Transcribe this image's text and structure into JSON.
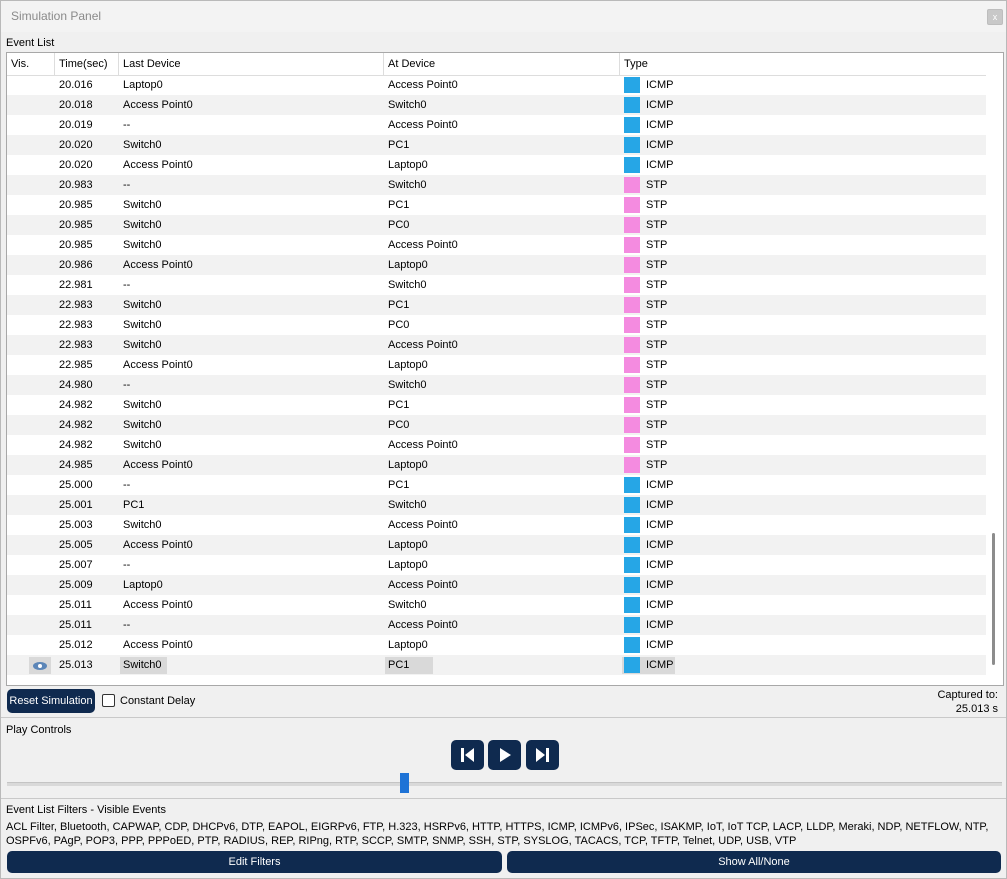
{
  "window": {
    "title": "Simulation Panel",
    "close_label": "x"
  },
  "event_list": {
    "label": "Event List",
    "columns": [
      "Vis.",
      "Time(sec)",
      "Last Device",
      "At Device",
      "Type"
    ],
    "rows": [
      {
        "time": "20.016",
        "last": "Laptop0",
        "at": "Access Point0",
        "type": "ICMP"
      },
      {
        "time": "20.018",
        "last": "Access Point0",
        "at": "Switch0",
        "type": "ICMP"
      },
      {
        "time": "20.019",
        "last": "--",
        "at": "Access Point0",
        "type": "ICMP"
      },
      {
        "time": "20.020",
        "last": "Switch0",
        "at": "PC1",
        "type": "ICMP"
      },
      {
        "time": "20.020",
        "last": "Access Point0",
        "at": "Laptop0",
        "type": "ICMP"
      },
      {
        "time": "20.983",
        "last": "--",
        "at": "Switch0",
        "type": "STP"
      },
      {
        "time": "20.985",
        "last": "Switch0",
        "at": "PC1",
        "type": "STP"
      },
      {
        "time": "20.985",
        "last": "Switch0",
        "at": "PC0",
        "type": "STP"
      },
      {
        "time": "20.985",
        "last": "Switch0",
        "at": "Access Point0",
        "type": "STP"
      },
      {
        "time": "20.986",
        "last": "Access Point0",
        "at": "Laptop0",
        "type": "STP"
      },
      {
        "time": "22.981",
        "last": "--",
        "at": "Switch0",
        "type": "STP"
      },
      {
        "time": "22.983",
        "last": "Switch0",
        "at": "PC1",
        "type": "STP"
      },
      {
        "time": "22.983",
        "last": "Switch0",
        "at": "PC0",
        "type": "STP"
      },
      {
        "time": "22.983",
        "last": "Switch0",
        "at": "Access Point0",
        "type": "STP"
      },
      {
        "time": "22.985",
        "last": "Access Point0",
        "at": "Laptop0",
        "type": "STP"
      },
      {
        "time": "24.980",
        "last": "--",
        "at": "Switch0",
        "type": "STP"
      },
      {
        "time": "24.982",
        "last": "Switch0",
        "at": "PC1",
        "type": "STP"
      },
      {
        "time": "24.982",
        "last": "Switch0",
        "at": "PC0",
        "type": "STP"
      },
      {
        "time": "24.982",
        "last": "Switch0",
        "at": "Access Point0",
        "type": "STP"
      },
      {
        "time": "24.985",
        "last": "Access Point0",
        "at": "Laptop0",
        "type": "STP"
      },
      {
        "time": "25.000",
        "last": "--",
        "at": "PC1",
        "type": "ICMP"
      },
      {
        "time": "25.001",
        "last": "PC1",
        "at": "Switch0",
        "type": "ICMP"
      },
      {
        "time": "25.003",
        "last": "Switch0",
        "at": "Access Point0",
        "type": "ICMP"
      },
      {
        "time": "25.005",
        "last": "Access Point0",
        "at": "Laptop0",
        "type": "ICMP"
      },
      {
        "time": "25.007",
        "last": "--",
        "at": "Laptop0",
        "type": "ICMP"
      },
      {
        "time": "25.009",
        "last": "Laptop0",
        "at": "Access Point0",
        "type": "ICMP"
      },
      {
        "time": "25.011",
        "last": "Access Point0",
        "at": "Switch0",
        "type": "ICMP"
      },
      {
        "time": "25.011",
        "last": "--",
        "at": "Access Point0",
        "type": "ICMP"
      },
      {
        "time": "25.012",
        "last": "Access Point0",
        "at": "Laptop0",
        "type": "ICMP"
      },
      {
        "time": "25.013",
        "last": "Switch0",
        "at": "PC1",
        "type": "ICMP",
        "selected": true,
        "vis_icon": "eye-icon"
      }
    ]
  },
  "type_colors": {
    "ICMP": "#26a6e6",
    "STP": "#f48be0"
  },
  "controls": {
    "reset_label": "Reset Simulation",
    "constant_delay_label": "Constant Delay",
    "constant_delay_checked": false,
    "captured_label": "Captured to:",
    "captured_value": "25.013 s"
  },
  "play_controls": {
    "label": "Play Controls",
    "buttons": [
      "step-back-icon",
      "play-icon",
      "step-forward-icon"
    ]
  },
  "filters": {
    "label": "Event List Filters - Visible Events",
    "text": "ACL Filter, Bluetooth, CAPWAP, CDP, DHCPv6, DTP, EAPOL, EIGRPv6, FTP, H.323, HSRPv6, HTTP, HTTPS, ICMP, ICMPv6, IPSec, ISAKMP, IoT, IoT TCP, LACP, LLDP, Meraki, NDP, NETFLOW, NTP, OSPFv6, PAgP, POP3, PPP, PPPoED, PTP, RADIUS, REP, RIPng, RTP, SCCP, SMTP, SNMP, SSH, STP, SYSLOG, TACACS, TCP, TFTP, Telnet, UDP, USB, VTP",
    "edit_label": "Edit Filters",
    "show_label": "Show All/None"
  }
}
